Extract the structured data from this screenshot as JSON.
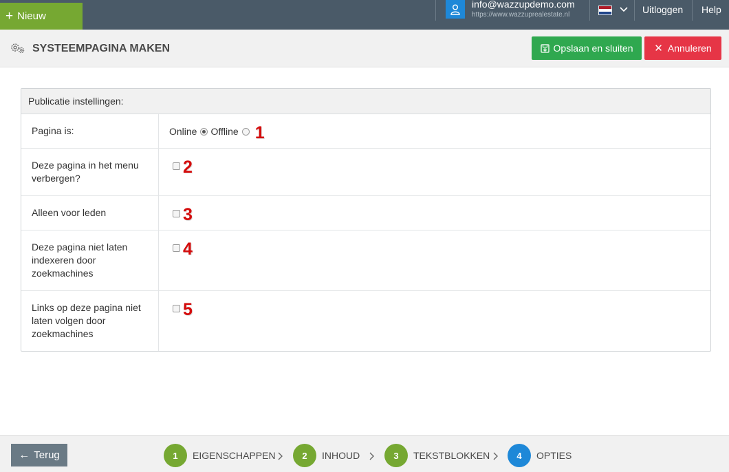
{
  "topbar": {
    "new_label": "Nieuw",
    "user_email": "info@wazzupdemo.com",
    "user_url": "https://www.wazzuprealestate.nl",
    "logout_label": "Uitloggen",
    "help_label": "Help",
    "bar_color": "#4a5a68",
    "new_color": "#76a832",
    "user_icon_color": "#1e88d8",
    "icons": [
      "plus-icon",
      "user-icon",
      "flag-nl-icon",
      "chevron-down-icon"
    ]
  },
  "header": {
    "title": "SYSTEEMPAGINA MAKEN",
    "save_label": "Opslaan en sluiten",
    "cancel_label": "Annuleren",
    "save_color": "#2fa84f",
    "cancel_color": "#e63546",
    "icons": [
      "gears-icon",
      "save-icon",
      "close-icon"
    ]
  },
  "panel": {
    "heading": "Publicatie instellingen:",
    "rows": [
      {
        "label": "Pagina is:",
        "options": [
          {
            "label": "Online",
            "selected": true
          },
          {
            "label": "Offline",
            "selected": false
          }
        ],
        "marker": "1"
      },
      {
        "label": "Deze pagina in het menu verbergen?",
        "checked": false,
        "marker": "2"
      },
      {
        "label": "Alleen voor leden",
        "checked": false,
        "marker": "3"
      },
      {
        "label": "Deze pagina niet laten indexeren door zoekmachines",
        "checked": false,
        "marker": "4"
      },
      {
        "label": "Links op deze pagina niet laten volgen door zoekmachines",
        "checked": false,
        "marker": "5"
      }
    ]
  },
  "footer": {
    "back_label": "Terug",
    "steps": [
      {
        "number": "1",
        "label": "EIGENSCHAPPEN",
        "color": "#76a832"
      },
      {
        "number": "2",
        "label": "INHOUD",
        "color": "#76a832"
      },
      {
        "number": "3",
        "label": "TEKSTBLOKKEN",
        "color": "#76a832"
      },
      {
        "number": "4",
        "label": "OPTIES",
        "color": "#1e88d8"
      }
    ]
  }
}
